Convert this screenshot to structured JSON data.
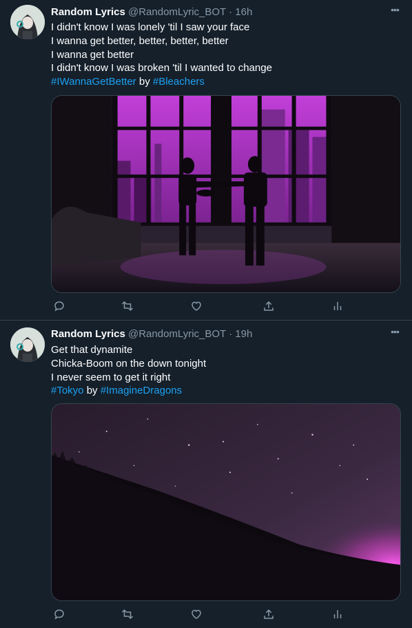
{
  "tweets": [
    {
      "name": "Random Lyrics",
      "handle": "@RandomLyric_BOT",
      "separator": "·",
      "time": "16h",
      "lines": [
        "I didn't know I was lonely 'til I saw your face",
        "I wanna get better, better, better, better",
        "I wanna get better",
        "I didn't know I was broken 'til I wanted to change"
      ],
      "hashtag_song": "#IWannaGetBetter",
      "by": "by",
      "hashtag_artist": "#Bleachers",
      "media_description": "city-window-couple-image"
    },
    {
      "name": "Random Lyrics",
      "handle": "@RandomLyric_BOT",
      "separator": "·",
      "time": "19h",
      "lines": [
        "Get that dynamite",
        "Chicka-Boom on the down tonight",
        "I never seem to get it right"
      ],
      "hashtag_song": "#Tokyo",
      "by": "by",
      "hashtag_artist": "#ImagineDragons",
      "media_description": "night-sky-hillside-image"
    }
  ],
  "more_label": "•••",
  "icons": [
    "reply-icon",
    "retweet-icon",
    "like-icon",
    "share-icon",
    "analytics-icon"
  ],
  "colors": {
    "background": "#15202b",
    "link": "#1da1f2",
    "secondary_text": "#8899a6",
    "divider": "#38444d",
    "media_tint": "#b040c8"
  }
}
